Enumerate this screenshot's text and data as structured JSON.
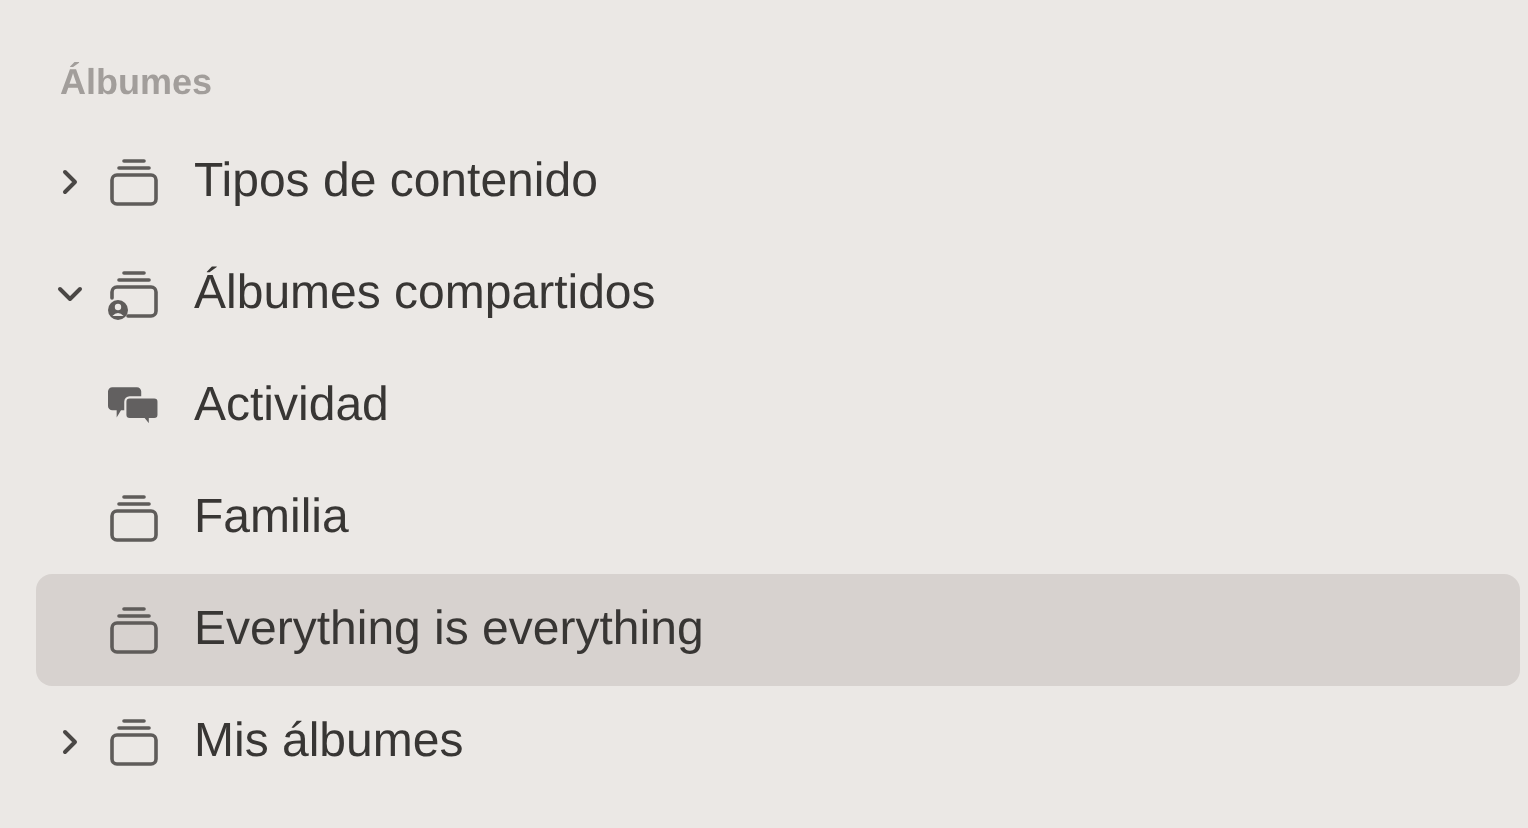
{
  "section": {
    "title": "Álbumes"
  },
  "items": [
    {
      "label": "Tipos de contenido",
      "kind": "album",
      "expanded": false,
      "selected": false
    },
    {
      "label": "Álbumes compartidos",
      "kind": "shared",
      "expanded": true,
      "selected": false,
      "children": [
        {
          "label": "Actividad",
          "kind": "activity",
          "selected": false
        },
        {
          "label": "Familia",
          "kind": "album",
          "selected": false
        },
        {
          "label": "Everything is everything",
          "kind": "album",
          "selected": true
        }
      ]
    },
    {
      "label": "Mis álbumes",
      "kind": "album",
      "expanded": false,
      "selected": false
    }
  ]
}
